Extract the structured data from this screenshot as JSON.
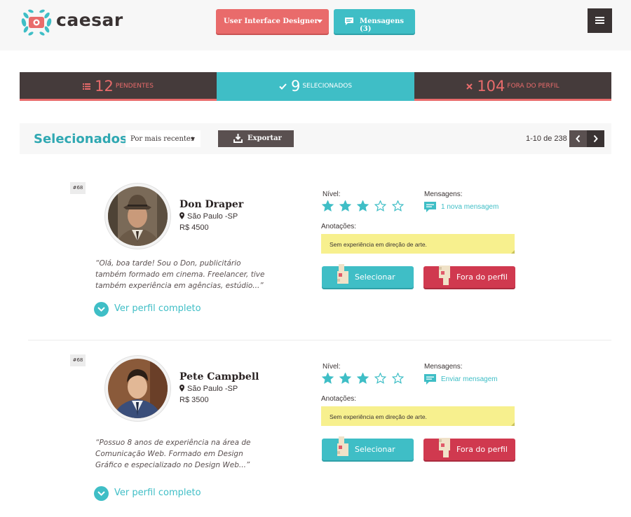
{
  "header": {
    "logo_text": "caesar",
    "role_select": "User Interface Designer",
    "messages_button": "Mensagens (3)"
  },
  "tabs": [
    {
      "count": "12",
      "label": "PENDENTES"
    },
    {
      "count": "9",
      "label": "SELECIONADOS"
    },
    {
      "count": "104",
      "label": "FORA DO PERFIL"
    }
  ],
  "toolbar": {
    "title": "Selecionados",
    "sort": "Por mais recentes",
    "export": "Exportar",
    "pagination": "1-10 de 238"
  },
  "labels": {
    "level": "Nível:",
    "messages": "Mensagens:",
    "notes": "Anotações:",
    "select": "Selecionar",
    "reject": "Fora do perfil",
    "more": "Ver perfil completo"
  },
  "candidates": [
    {
      "badge": "#68",
      "name": "Don Draper",
      "location": "São Paulo -SP",
      "salary": "R$ 4500",
      "quote": "“Olá, boa tarde! Sou o Don, publicitário também formado em cinema. Freelancer, tive também experiência em agências, estúdio...”",
      "rating": 3,
      "rating_max": 5,
      "message_link": "1 nova mensagem",
      "note": "Sem experiência em direção de arte."
    },
    {
      "badge": "#68",
      "name": "Pete Campbell",
      "location": "São Paulo -SP",
      "salary": "R$ 3500",
      "quote": "“Possuo 8 anos de experiência na área de Comunicação Web. Formado em Design Gráfico e especializado no Design Web...”",
      "rating": 3,
      "rating_max": 5,
      "message_link": "Enviar mensagem",
      "note": "Sem experiência em direção de arte."
    }
  ],
  "colors": {
    "accent": "#3fbec6",
    "coral": "#e96b6b",
    "dark": "#453b3b",
    "reject": "#d0394f",
    "note": "#f7f08e"
  }
}
